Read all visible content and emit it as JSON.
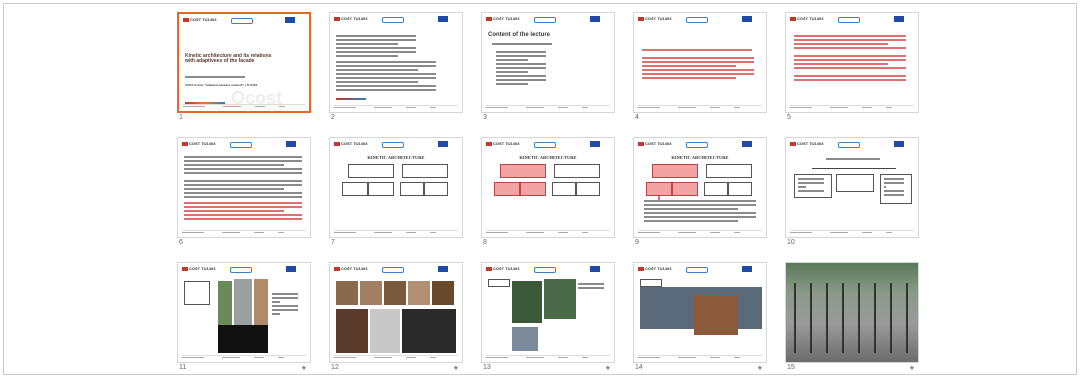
{
  "slides": [
    {
      "number": "1",
      "title": "Kinetic architecture and its relations with adaptivees of the facade",
      "line": "COST Action \"Adaptive facades network\" | TU1403",
      "selected": true
    },
    {
      "number": "2"
    },
    {
      "number": "3",
      "title": "Content of the lecture"
    },
    {
      "number": "4"
    },
    {
      "number": "5"
    },
    {
      "number": "6"
    },
    {
      "number": "7",
      "title": "KINETIC ARCHITECTURE"
    },
    {
      "number": "8",
      "title": "KINETIC ARCHITECTURE"
    },
    {
      "number": "9",
      "title": "KINETIC ARCHITECTURE"
    },
    {
      "number": "10"
    },
    {
      "number": "11"
    },
    {
      "number": "12"
    },
    {
      "number": "13"
    },
    {
      "number": "14"
    },
    {
      "number": "15"
    }
  ],
  "header": {
    "brand": "COST TU1403"
  },
  "colors": {
    "selected_border": "#e06a2a",
    "highlight": "#f3a3a3"
  }
}
